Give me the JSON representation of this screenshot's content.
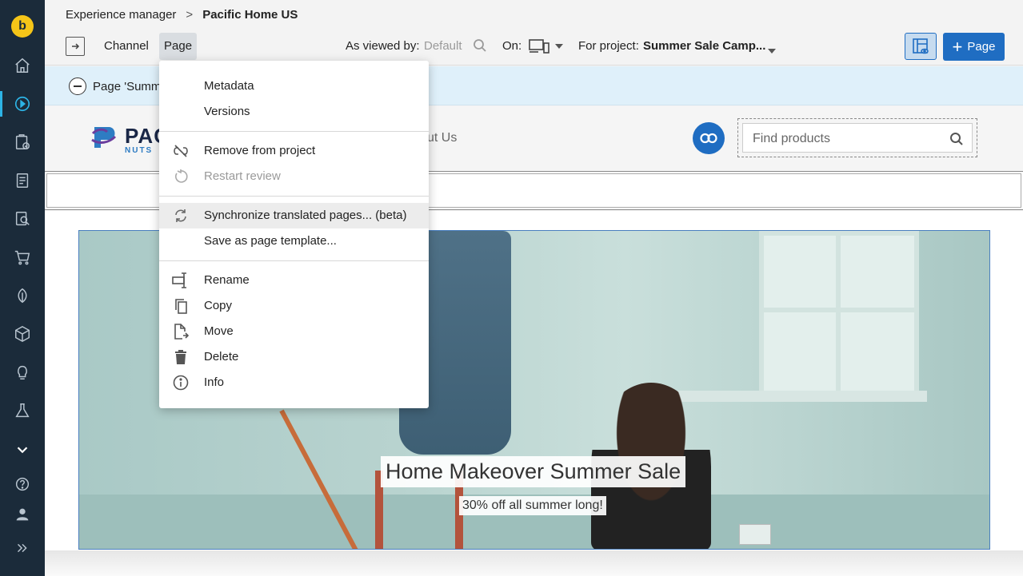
{
  "rail": {
    "logo": "b",
    "items": [
      "home-icon",
      "experience-manager-icon",
      "workflow-icon",
      "documents-icon",
      "content-search-icon",
      "cart-icon",
      "leaf-icon",
      "cube-icon",
      "bulb-icon",
      "lab-icon",
      "heart-icon",
      "help-icon",
      "user-icon",
      "expand-icon"
    ],
    "active_color": "#2db4e6",
    "bg_color": "#1b2b3a"
  },
  "breadcrumb": {
    "root": "Experience manager",
    "separator": ">",
    "current": "Pacific Home US"
  },
  "toolbar": {
    "channel": "Channel",
    "page": "Page",
    "viewed_by_label": "As viewed by:",
    "viewed_by_value": "Default",
    "on_label": "On:",
    "project_label": "For project:",
    "project_value": "Summer Sale Camp...",
    "add_page_label": "Page",
    "accent_color": "#1f6dc2"
  },
  "banner": {
    "text": "Page 'Summe"
  },
  "site": {
    "logo_word1": "PAC",
    "logo_word2": "NUTS",
    "nav_text": "ut Us",
    "search_placeholder": "Find products",
    "hero_title": "Home Makeover Summer Sale",
    "hero_subtitle": "30% off all summer long!"
  },
  "page_menu": {
    "groups": [
      [
        {
          "label": "Metadata",
          "icon": "",
          "disabled": false
        },
        {
          "label": "Versions",
          "icon": "",
          "disabled": false
        }
      ],
      [
        {
          "label": "Remove from project",
          "icon": "unlink-icon",
          "disabled": false
        },
        {
          "label": "Restart review",
          "icon": "restart-icon",
          "disabled": true
        }
      ],
      [
        {
          "label": "Synchronize translated pages... (beta)",
          "icon": "sync-icon",
          "disabled": false,
          "hover": true
        },
        {
          "label": "Save as page template...",
          "icon": "",
          "disabled": false
        }
      ],
      [
        {
          "label": "Rename",
          "icon": "rename-icon",
          "disabled": false
        },
        {
          "label": "Copy",
          "icon": "copy-icon",
          "disabled": false
        },
        {
          "label": "Move",
          "icon": "move-icon",
          "disabled": false
        },
        {
          "label": "Delete",
          "icon": "trash-icon",
          "disabled": false
        },
        {
          "label": "Info",
          "icon": "info-icon",
          "disabled": false
        }
      ]
    ]
  }
}
